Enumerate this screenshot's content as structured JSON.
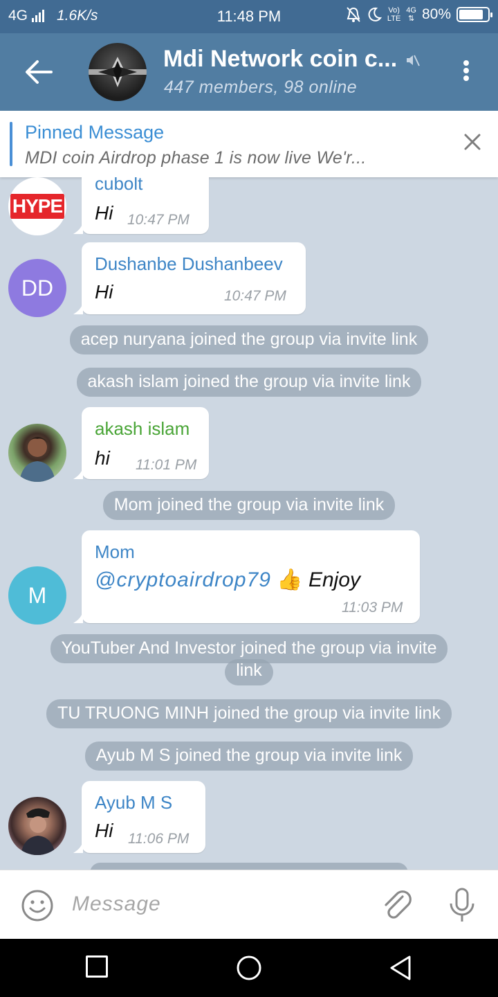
{
  "status_bar": {
    "network": "4G",
    "speed": "1.6K/s",
    "time": "11:48 PM",
    "volte_top": "Vo)",
    "volte_bottom": "LTE",
    "net_top": "4G",
    "battery": "80%"
  },
  "header": {
    "title": "Mdi Network coin c...",
    "subtitle": "447 members, 98 online"
  },
  "pinned": {
    "title": "Pinned Message",
    "text": "MDI coin Airdrop phase 1 is now live We'r..."
  },
  "messages": [
    {
      "sender": "cubolt",
      "text": "Hi",
      "time": "10:47 PM",
      "avatar_text": "HYPE"
    },
    {
      "sender": "Dushanbe Dushanbeev",
      "text": "Hi",
      "time": "10:47 PM",
      "avatar_initials": "DD"
    },
    {
      "sender": "akash islam",
      "text": "hi",
      "time": "11:01 PM"
    },
    {
      "sender": "Mom",
      "mention": "@cryptoairdrop79",
      "emoji": "👍",
      "text": "Enjoy",
      "time": "11:03 PM",
      "avatar_initials": "M"
    },
    {
      "sender": "Ayub M S",
      "text": "Hi",
      "time": "11:06 PM"
    }
  ],
  "system_messages": [
    "acep nuryana joined the group via invite link",
    "akash islam joined the group via invite link",
    "Mom joined the group via invite link",
    "YouTuber And Investor joined the group via invite",
    "link",
    "TU TRUONG MINH joined the group via invite link",
    "Ayub M S joined the group via invite link"
  ],
  "input": {
    "placeholder": "Message"
  },
  "colors": {
    "header": "#517da2",
    "status": "#416b93",
    "name_dd": "#3d85c6",
    "name_green": "#4aa537",
    "avatar_dd": "#8e7ae0",
    "avatar_m": "#4fbcd7"
  }
}
